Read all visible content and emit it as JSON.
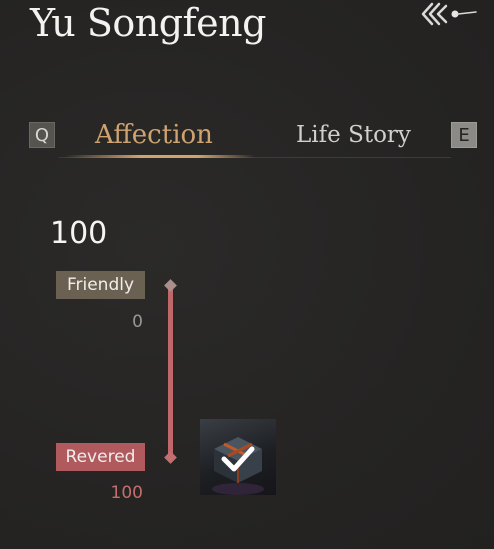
{
  "header": {
    "title": "Yu Songfeng",
    "back_icon": "back-arrow-icon"
  },
  "tabs": {
    "prev_key": "Q",
    "next_key": "E",
    "items": [
      {
        "label": "Affection",
        "active": true
      },
      {
        "label": "Life Story",
        "active": false
      }
    ]
  },
  "affection": {
    "current_value": "100",
    "tiers": [
      {
        "label": "Friendly",
        "threshold": "0",
        "color": "#6b6152"
      },
      {
        "label": "Revered",
        "threshold": "100",
        "color": "#b05a5e"
      }
    ],
    "reward": {
      "icon": "gift-box-icon",
      "claimed": true,
      "status_icon": "checkmark-icon"
    }
  },
  "colors": {
    "accent": "#cfa370",
    "track": "#c0676a",
    "background": "#272625"
  }
}
